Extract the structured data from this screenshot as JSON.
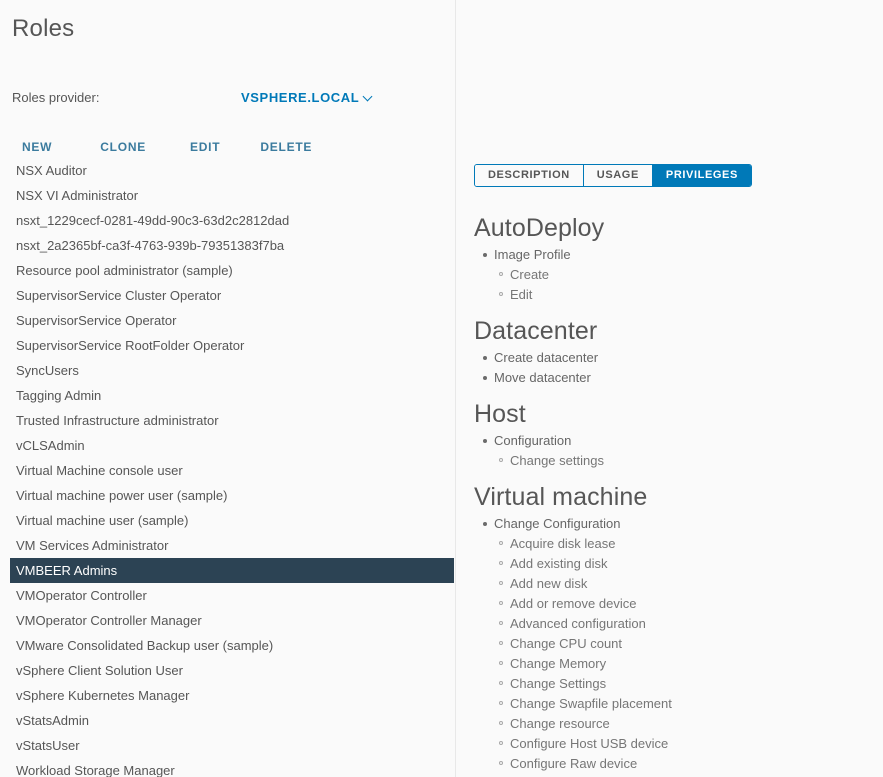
{
  "page": {
    "title": "Roles"
  },
  "provider": {
    "label": "Roles provider:",
    "value": "VSPHERE.LOCAL",
    "chevron_icon": "chevron-down-icon"
  },
  "toolbar": {
    "new_label": "NEW",
    "clone_label": "CLONE",
    "edit_label": "EDIT",
    "delete_label": "DELETE"
  },
  "roles": {
    "selected": "VMBEER Admins",
    "items": [
      {
        "label": "NSX Auditor",
        "selected": false
      },
      {
        "label": "NSX VI Administrator",
        "selected": false
      },
      {
        "label": "nsxt_1229cecf-0281-49dd-90c3-63d2c2812dad",
        "selected": false
      },
      {
        "label": "nsxt_2a2365bf-ca3f-4763-939b-79351383f7ba",
        "selected": false
      },
      {
        "label": "Resource pool administrator (sample)",
        "selected": false
      },
      {
        "label": "SupervisorService Cluster Operator",
        "selected": false
      },
      {
        "label": "SupervisorService Operator",
        "selected": false
      },
      {
        "label": "SupervisorService RootFolder Operator",
        "selected": false
      },
      {
        "label": "SyncUsers",
        "selected": false
      },
      {
        "label": "Tagging Admin",
        "selected": false
      },
      {
        "label": "Trusted Infrastructure administrator",
        "selected": false
      },
      {
        "label": "vCLSAdmin",
        "selected": false
      },
      {
        "label": "Virtual Machine console user",
        "selected": false
      },
      {
        "label": "Virtual machine power user (sample)",
        "selected": false
      },
      {
        "label": "Virtual machine user (sample)",
        "selected": false
      },
      {
        "label": "VM Services Administrator",
        "selected": false
      },
      {
        "label": "VMBEER Admins",
        "selected": true
      },
      {
        "label": "VMOperator Controller",
        "selected": false
      },
      {
        "label": "VMOperator Controller Manager",
        "selected": false
      },
      {
        "label": "VMware Consolidated Backup user (sample)",
        "selected": false
      },
      {
        "label": "vSphere Client Solution User",
        "selected": false
      },
      {
        "label": "vSphere Kubernetes Manager",
        "selected": false
      },
      {
        "label": "vStatsAdmin",
        "selected": false
      },
      {
        "label": "vStatsUser",
        "selected": false
      },
      {
        "label": "Workload Storage Manager",
        "selected": false
      }
    ]
  },
  "detail": {
    "tabs": [
      {
        "label": "DESCRIPTION",
        "active": false
      },
      {
        "label": "USAGE",
        "active": false
      },
      {
        "label": "PRIVILEGES",
        "active": true
      }
    ],
    "privileges": [
      {
        "heading": "AutoDeploy",
        "items": [
          {
            "label": "Image Profile",
            "children": [
              "Create",
              "Edit"
            ]
          }
        ]
      },
      {
        "heading": "Datacenter",
        "items": [
          {
            "label": "Create datacenter",
            "children": []
          },
          {
            "label": "Move datacenter",
            "children": []
          }
        ]
      },
      {
        "heading": "Host",
        "items": [
          {
            "label": "Configuration",
            "children": [
              "Change settings"
            ]
          }
        ]
      },
      {
        "heading": "Virtual machine",
        "items": [
          {
            "label": "Change Configuration",
            "children": [
              "Acquire disk lease",
              "Add existing disk",
              "Add new disk",
              "Add or remove device",
              "Advanced configuration",
              "Change CPU count",
              "Change Memory",
              "Change Settings",
              "Change Swapfile placement",
              "Change resource",
              "Configure Host USB device",
              "Configure Raw device"
            ]
          }
        ]
      }
    ]
  },
  "colors": {
    "accent_blue": "#0079b8",
    "link_blue": "#3b7b9e",
    "selected_row": "#2c4354",
    "text_gray": "#565656",
    "page_bg": "#fafafa"
  }
}
